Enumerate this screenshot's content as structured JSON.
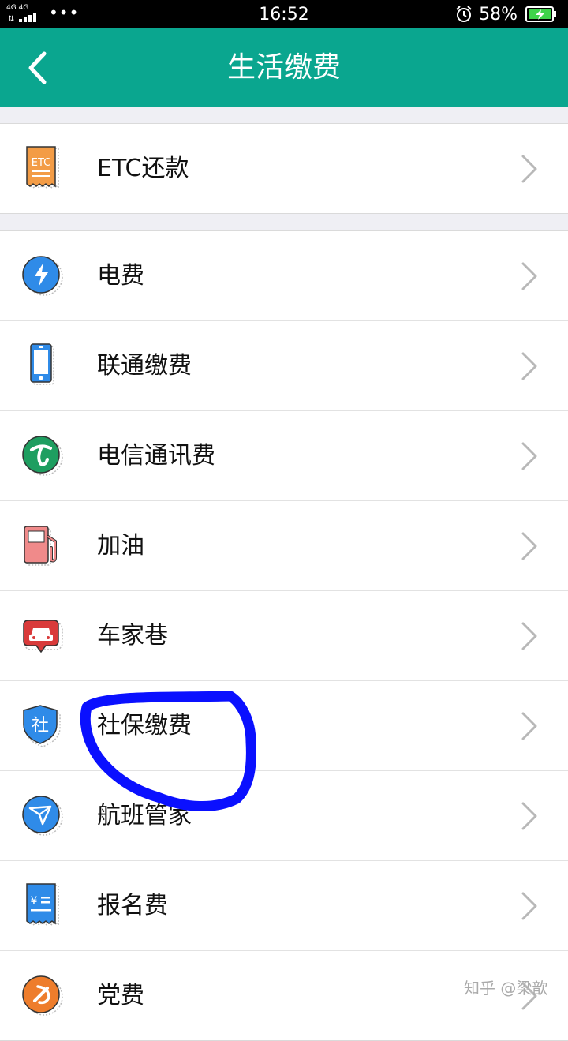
{
  "status_bar": {
    "network": "4G 4G",
    "dots": "•••",
    "time": "16:52",
    "battery": "58%",
    "icons": [
      "signal-icon",
      "alarm-icon",
      "battery-charging-icon"
    ]
  },
  "nav": {
    "title": "生活缴费",
    "back_icon": "chevron-left-icon"
  },
  "groups": [
    {
      "items": [
        {
          "label": "ETC还款",
          "icon": "etc-ticket-icon",
          "icon_text": "ETC",
          "color": "#f39c46"
        }
      ]
    },
    {
      "items": [
        {
          "label": "电费",
          "icon": "lightning-icon",
          "color": "#2f8be8"
        },
        {
          "label": "联通缴费",
          "icon": "phone-icon",
          "color": "#2f8be8"
        },
        {
          "label": "电信通讯费",
          "icon": "telecom-icon",
          "color": "#1e9e60"
        },
        {
          "label": "加油",
          "icon": "fuel-pump-icon",
          "color": "#f08a8a"
        },
        {
          "label": "车家巷",
          "icon": "car-icon",
          "color": "#d93a3a"
        },
        {
          "label": "社保缴费",
          "icon": "shield-icon",
          "icon_text": "社",
          "color": "#2f8be8"
        },
        {
          "label": "航班管家",
          "icon": "plane-icon",
          "color": "#2f8be8"
        },
        {
          "label": "报名费",
          "icon": "fee-ticket-icon",
          "icon_text": "¥",
          "color": "#2f8be8"
        },
        {
          "label": "党费",
          "icon": "party-icon",
          "color": "#ee7d2c"
        }
      ]
    }
  ],
  "annotation": {
    "color": "#0a10ff",
    "target": "社保缴费"
  },
  "watermark": "知乎 @梁歆"
}
